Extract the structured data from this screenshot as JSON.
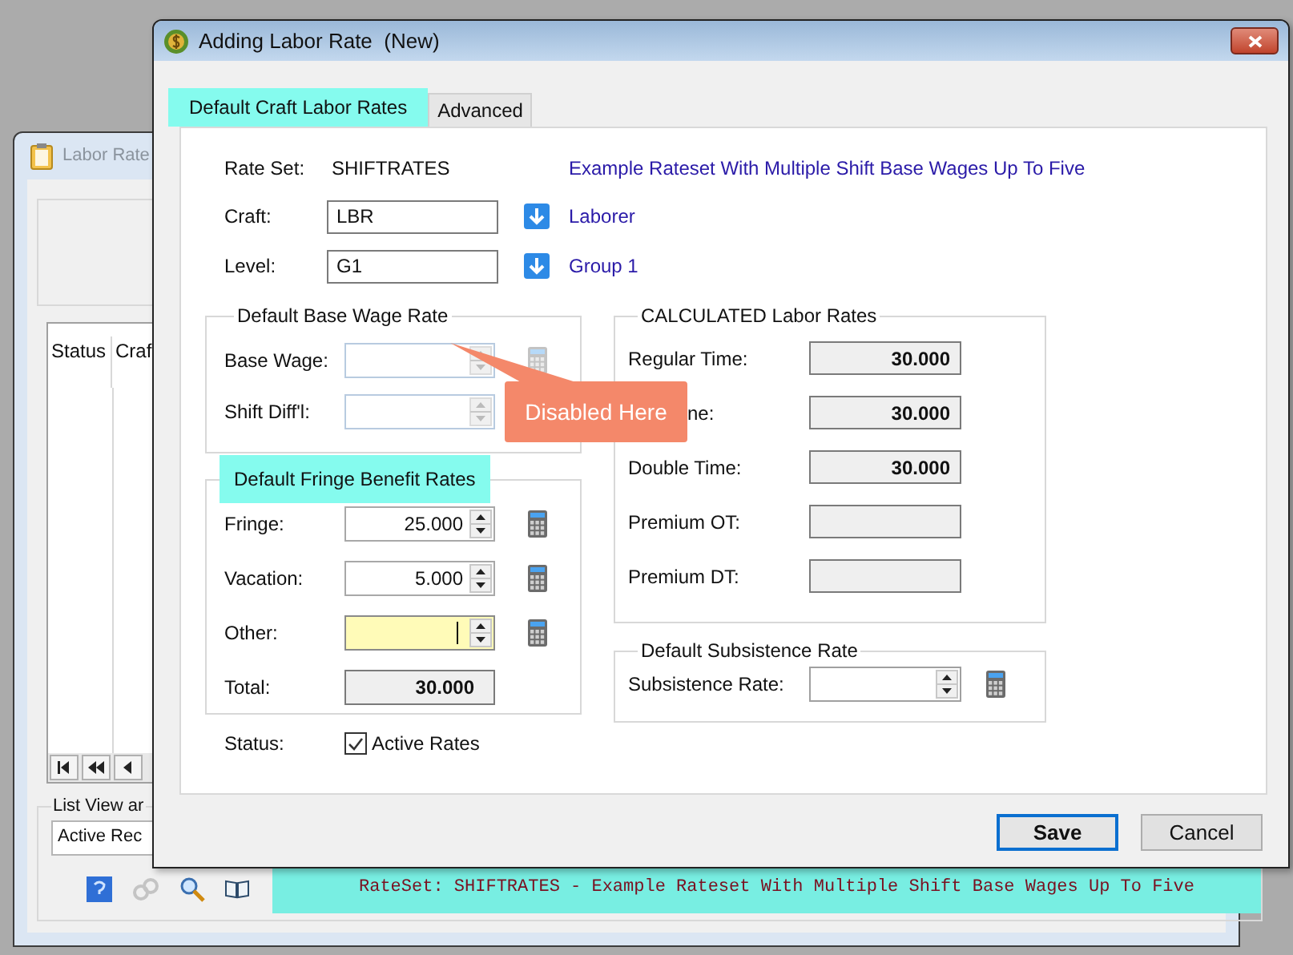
{
  "background_window": {
    "title": "Labor Rate",
    "grid_columns": [
      "Status",
      "Craf"
    ],
    "list_view_group": "List View ar",
    "list_view_value": "Active Rec",
    "status_text": "RateSet: SHIFTRATES - Example Rateset With Multiple Shift Base Wages Up To Five"
  },
  "dialog": {
    "title": "Adding Labor Rate  (New)",
    "tabs": [
      {
        "label": "Default Craft Labor Rates",
        "selected": true,
        "highlighted": true
      },
      {
        "label": "Advanced",
        "selected": false,
        "highlighted": false
      }
    ],
    "rate_set": {
      "label": "Rate Set:",
      "value": "SHIFTRATES",
      "description": "Example Rateset With Multiple Shift Base Wages Up To Five"
    },
    "lookups": [
      {
        "label": "Craft:",
        "value": "LBR",
        "description": "Laborer"
      },
      {
        "label": "Level:",
        "value": "G1",
        "description": "Group 1"
      }
    ],
    "base_wage_group": {
      "title": "Default Base Wage Rate",
      "fields": [
        {
          "label": "Base Wage:",
          "disabled": true,
          "kind": "spin_calc"
        },
        {
          "label": "Shift Diff'l:",
          "disabled": true,
          "kind": "spin"
        }
      ]
    },
    "fringe_group": {
      "title": "Default Fringe Benefit Rates",
      "highlighted": true,
      "fields": [
        {
          "label": "Fringe:",
          "value": "25.000",
          "kind": "spin",
          "focused": false
        },
        {
          "label": "Vacation:",
          "value": "5.000",
          "kind": "spin",
          "focused": false
        },
        {
          "label": "Other:",
          "kind": "spin",
          "focused": true
        },
        {
          "label": "Total:",
          "value": "30.000",
          "kind": "total"
        }
      ]
    },
    "status": {
      "label": "Status:",
      "checkbox": {
        "label": "Active Rates",
        "checked": true
      }
    },
    "calculated_group": {
      "title": "CALCULATED Labor Rates",
      "fields": [
        {
          "label": "Regular Time:",
          "value": "30.000",
          "kind": "label"
        },
        {
          "label": "ne:",
          "value": "30.000",
          "kind": "label_tail"
        },
        {
          "label": "Double Time:",
          "value": "30.000",
          "kind": "label"
        },
        {
          "label": "Premium OT:",
          "kind": "label"
        },
        {
          "label": "Premium DT:",
          "kind": "label"
        }
      ]
    },
    "subsistence_group": {
      "title": "Default Subsistence Rate",
      "fields": [
        {
          "label": "Subsistence Rate:"
        }
      ]
    },
    "buttons": [
      {
        "label": "Save",
        "default": true
      },
      {
        "label": "Cancel",
        "default": false
      }
    ],
    "callout": {
      "text": "Disabled Here"
    }
  }
}
